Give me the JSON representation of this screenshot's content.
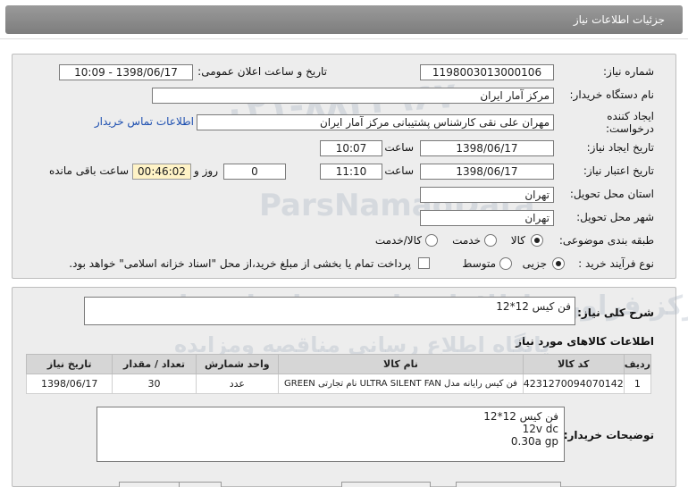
{
  "page_title": "جزئیات اطلاعات نیاز",
  "fields": {
    "need_number_label": "شماره نیاز:",
    "need_number": "1198003013000106",
    "announce_label": "تاریخ و ساعت اعلان عمومی:",
    "announce_value": "1398/06/17 - 10:09",
    "buyer_org_label": "نام دستگاه خریدار:",
    "buyer_org": "مرکز آمار ایران",
    "creator_label_1": "ایجاد کننده",
    "creator_label_2": "درخواست:",
    "creator": "مهران  علی نقی کارشناس پشتیبانی مرکز آمار ایران",
    "contact_link": "اطلاعات تماس خریدار",
    "create_date_label": "تاریخ ایجاد نیاز:",
    "create_date": "1398/06/17",
    "time_label": "ساعت",
    "create_time": "10:07",
    "validity_label": "تاریخ اعتبار نیاز:",
    "validity_date": "1398/06/17",
    "validity_time": "11:10",
    "days_value": "0",
    "days_label": "روز و",
    "remaining_time": "00:46:02",
    "remaining_label": "ساعت باقی مانده",
    "province_label": "استان محل تحویل:",
    "province": "تهران",
    "city_label": "شهر محل تحویل:",
    "city": "تهران",
    "category_label": "طبقه بندی موضوعی:",
    "category_options": [
      "کالا",
      "خدمت",
      "کالا/خدمت"
    ],
    "category_selected": 0,
    "process_label": "نوع فرآیند خرید :",
    "process_options": [
      "جزیی",
      "متوسط"
    ],
    "process_selected": 0,
    "payment_note": "پرداخت تمام یا بخشی از مبلغ خرید،از محل \"اسناد خزانه اسلامی\" خواهد بود."
  },
  "summary": {
    "label": "شرح کلی نیاز:",
    "value": "فن کیس 12*12"
  },
  "items_section_title": "اطلاعات کالاهای مورد نیاز",
  "table": {
    "headers": [
      "ردیف",
      "کد کالا",
      "نام کالا",
      "واحد شمارش",
      "تعداد / مقدار",
      "تاریخ نیاز"
    ],
    "rows": [
      [
        "1",
        "4231270094070142",
        "فن کیس رایانه مدل ULTRA SILENT FAN نام تجارتی GREEN",
        "عدد",
        "30",
        "1398/06/17"
      ]
    ]
  },
  "buyer_notes": {
    "label": "توضیحات خریدار:",
    "lines": [
      "فن کیس 12*12",
      "12v dc",
      "0.30a gp"
    ]
  },
  "watermark": {
    "line1": "ParsNamadData",
    "line2": "مرکز فراوری اطلاعات پارس نماد داده ها",
    "line3": "پایگاه اطلاع رسانی مناقصه ومزایده",
    "line4": "۰۲۱-۸۸۳۴۹۶۷۰"
  }
}
